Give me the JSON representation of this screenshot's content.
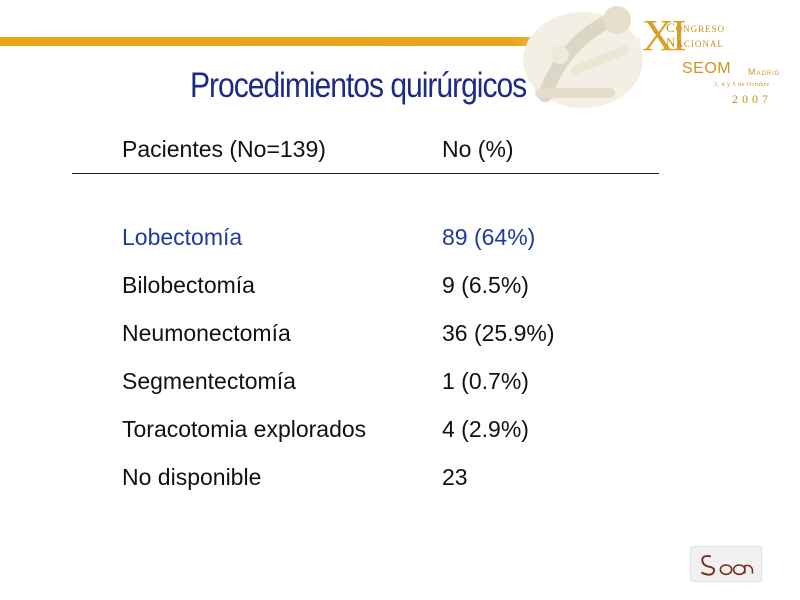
{
  "slide": {
    "title": "Procedimientos quirúrgicos"
  },
  "logo": {
    "xi": "XI",
    "congress_line1": "Congreso",
    "congress_line2": "Nacional",
    "seom": "SEOM",
    "city": "Madrid",
    "dates": "3, 4 y 5 de Octubre",
    "year": "2007",
    "bottom_logo_icon": "seom-logo-icon"
  },
  "table": {
    "headers": [
      "Pacientes (No=139)",
      "No (%)"
    ],
    "rows": [
      [
        "Lobectomía",
        "89 (64%)"
      ],
      [
        "Bilobectomía",
        "9 (6.5%)"
      ],
      [
        "Neumonectomía",
        "36 (25.9%)"
      ],
      [
        "Segmentectomía",
        "1 (0.7%)"
      ],
      [
        "Toracotomia explorados",
        "4 (2.9%)"
      ],
      [
        "No disponible",
        "23"
      ]
    ],
    "highlight_row_index": 0
  },
  "colors": {
    "title": "#1f2a86",
    "highlight": "#1f3a9e",
    "band": "#e9a51c",
    "text": "#111111"
  }
}
